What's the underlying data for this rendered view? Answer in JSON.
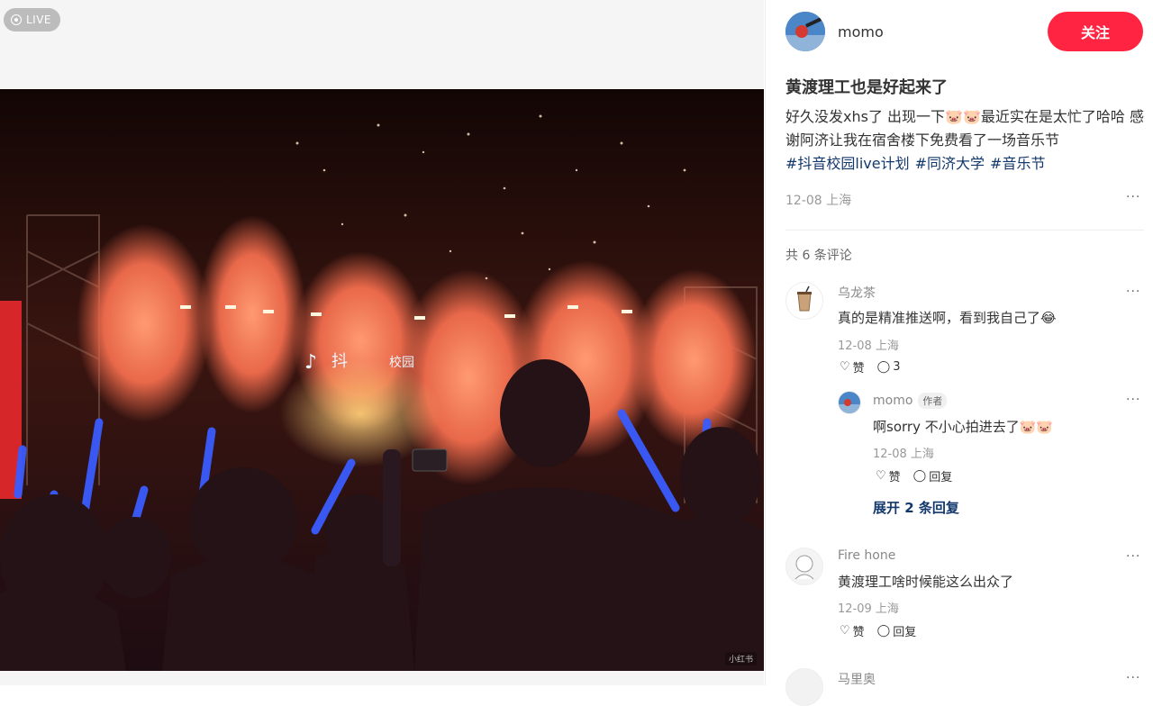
{
  "live_badge": {
    "label": "LIVE"
  },
  "photo": {
    "watermark": "小红书",
    "sign_text_1": "抖",
    "sign_text_2": "校园"
  },
  "author": {
    "name": "momo",
    "follow_label": "关注"
  },
  "post": {
    "title": "黄渡理工也是好起来了",
    "body": "好久没发xhs了 出现一下🐷🐷最近实在是太忙了哈哈 感谢阿济让我在宿舍楼下免费看了一场音乐节",
    "tags": [
      "#抖音校园live计划",
      "#同济大学",
      "#音乐节"
    ],
    "meta": "12-08 上海",
    "more": "···"
  },
  "comments_count": "共 6 条评论",
  "comments": [
    {
      "name": "乌龙茶",
      "text": "真的是精准推送啊，看到我自己了😂",
      "date": "12-08 上海",
      "like_label": "赞",
      "reply_count": "3",
      "reply": {
        "name": "momo",
        "author_tag": "作者",
        "text": "啊sorry 不小心拍进去了🐷🐷",
        "date": "12-08 上海",
        "like_label": "赞",
        "reply_label": "回复"
      },
      "expand_label": "展开 2 条回复"
    },
    {
      "name": "Fire hone",
      "text": "黄渡理工啥时候能这么出众了",
      "date": "12-09 上海",
      "like_label": "赞",
      "reply_label": "回复"
    },
    {
      "name": "马里奥"
    }
  ],
  "colors": {
    "accent": "#ff2442",
    "tag": "#13386c",
    "muted": "#999999"
  }
}
